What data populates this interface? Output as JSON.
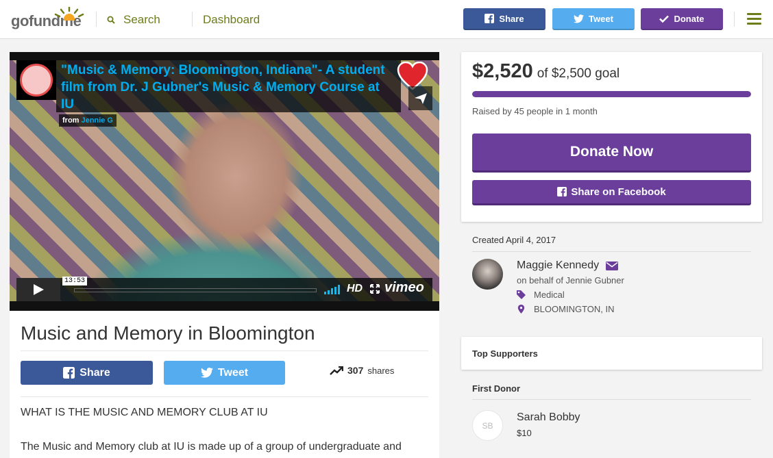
{
  "header": {
    "logo_text_go": "go",
    "logo_text_fund": "fund",
    "logo_text_me": "me",
    "search_label": "Search",
    "dashboard_label": "Dashboard",
    "share_label": "Share",
    "tweet_label": "Tweet",
    "donate_label": "Donate",
    "accent_color": "#6c7d1a"
  },
  "video": {
    "title": "\"Music & Memory: Bloomington, Indiana\"- A student film from Dr. J Gubner's Music & Memory Course at IU",
    "from_label": "from",
    "from_name": "Jennie G",
    "duration": "13:53",
    "hd_label": "HD",
    "brand": "vimeo"
  },
  "campaign": {
    "title": "Music and Memory in Bloomington",
    "share_label": "Share",
    "tweet_label": "Tweet",
    "shares_count": "307",
    "shares_label": "shares",
    "story_heading": "WHAT IS THE MUSIC AND MEMORY CLUB AT IU",
    "story_text": "The Music and Memory club at IU is made up of a group of undergraduate and"
  },
  "donation": {
    "raised": "$2,520",
    "goal_text": "of $2,500 goal",
    "progress_fraction": 1.0,
    "raised_by": "Raised by 45 people in 1 month",
    "donate_now_label": "Donate Now",
    "share_fb_label": "Share on Facebook",
    "brand_color": "#6b3e9c"
  },
  "organizer": {
    "created": "Created April 4, 2017",
    "name": "Maggie Kennedy",
    "behalf": "on behalf of Jennie Gubner",
    "category": "Medical",
    "location": "BLOOMINGTON, IN"
  },
  "supporters": {
    "top_label": "Top Supporters",
    "first_label": "First Donor",
    "first_initials": "SB",
    "first_name": "Sarah Bobby",
    "first_amount": "$10"
  }
}
